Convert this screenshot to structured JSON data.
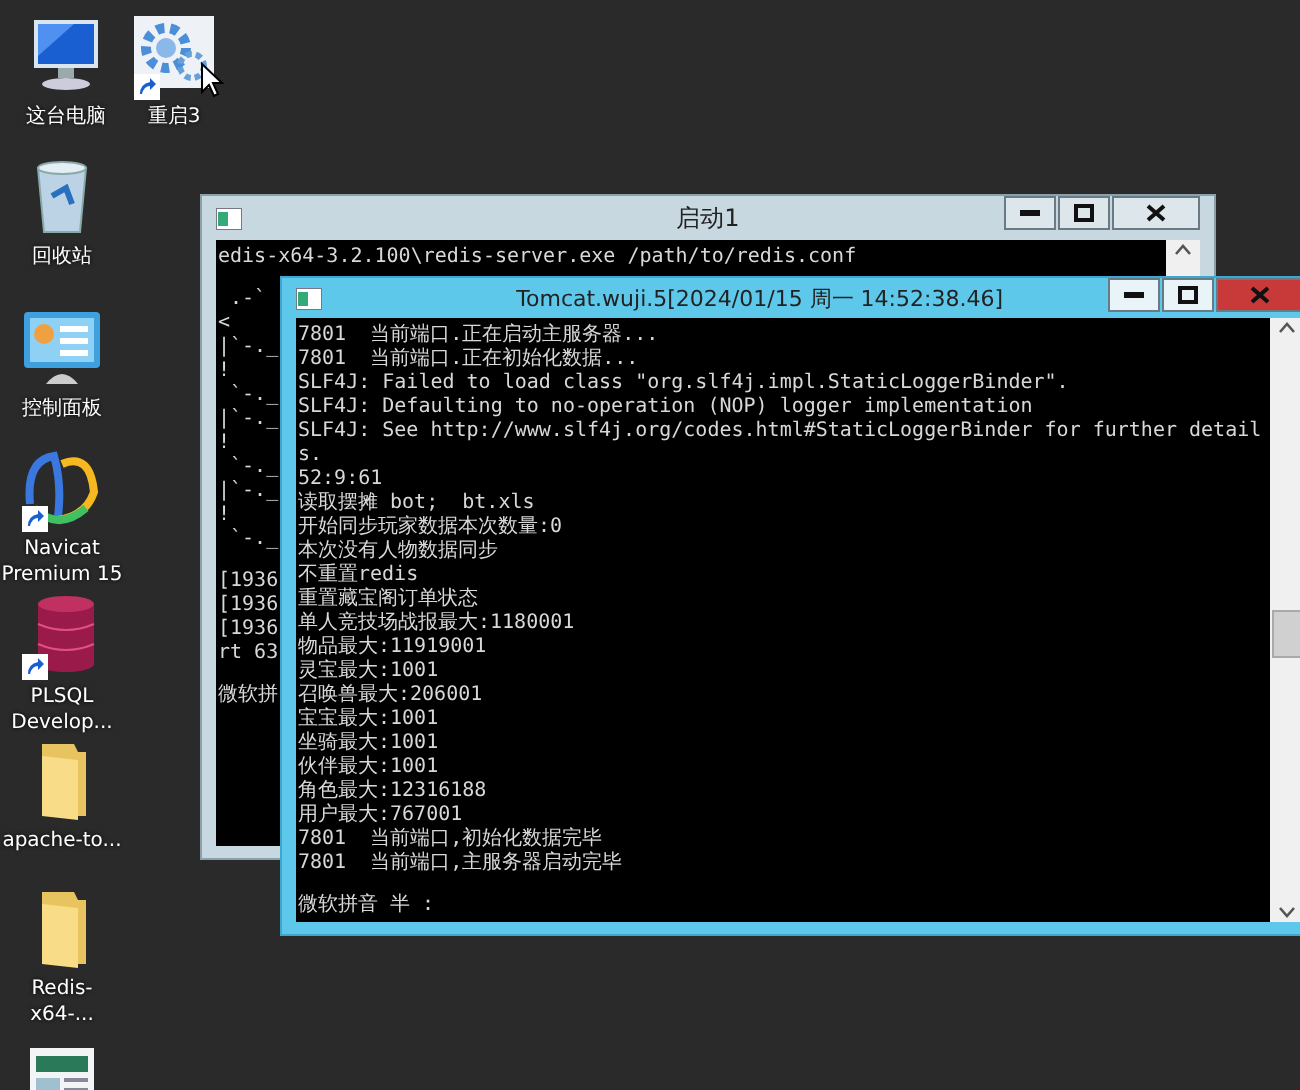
{
  "desktop_icons": [
    {
      "label": "这台电脑",
      "kind": "computer",
      "shortcut": false
    },
    {
      "label": "重启3",
      "kind": "gear",
      "shortcut": true
    },
    {
      "label": "回收站",
      "kind": "recycle-bin",
      "shortcut": false
    },
    {
      "label": "控制面板",
      "kind": "control-panel",
      "shortcut": false
    },
    {
      "label": "Navicat Premium 15",
      "kind": "navicat",
      "shortcut": true
    },
    {
      "label": "PLSQL Develop...",
      "kind": "database",
      "shortcut": true
    },
    {
      "label": "apache-to...",
      "kind": "folder",
      "shortcut": false
    },
    {
      "label": "Redis-x64-...",
      "kind": "folder",
      "shortcut": false
    },
    {
      "kind": "document"
    }
  ],
  "windows": [
    {
      "title": "启动1",
      "active": false,
      "console_blocks": [
        [
          "edis-x64-3.2.100\\redis-server.exe /path/to/redis.conf"
        ],
        [
          " .-`",
          "<",
          "|`-._",
          "!",
          " `-._",
          "|`-._",
          "!",
          " `-._",
          "|`-._",
          "!",
          " `-._"
        ],
        [
          "[1936",
          "[1936",
          "[1936",
          "rt 63"
        ],
        [
          "微软拼"
        ]
      ]
    },
    {
      "title": "Tomcat.wuji.5[2024/01/15 周一 14:52:38.46]",
      "active": true,
      "console_blocks": [
        [
          "7801  当前端口.正在启动主服务器...",
          "7801  当前端口.正在初始化数据...",
          "SLF4J: Failed to load class \"org.slf4j.impl.StaticLoggerBinder\".",
          "SLF4J: Defaulting to no-operation (NOP) logger implementation",
          "SLF4J: See http://www.slf4j.org/codes.html#StaticLoggerBinder for further detail",
          "s.",
          "52:9:61",
          "读取摆摊 bot;  bt.xls",
          "开始同步玩家数据本次数量:0",
          "本次没有人物数据同步",
          "不重置redis",
          "重置藏宝阁订单状态",
          "单人竞技场战报最大:1180001",
          "物品最大:11919001",
          "灵宝最大:1001",
          "召唤兽最大:206001",
          "宝宝最大:1001",
          "坐骑最大:1001",
          "伙伴最大:1001",
          "角色最大:12316188",
          "用户最大:767001",
          "7801  当前端口,初始化数据完毕",
          "7801  当前端口,主服务器启动完毕"
        ],
        [
          "微软拼音 半 :"
        ]
      ]
    }
  ]
}
